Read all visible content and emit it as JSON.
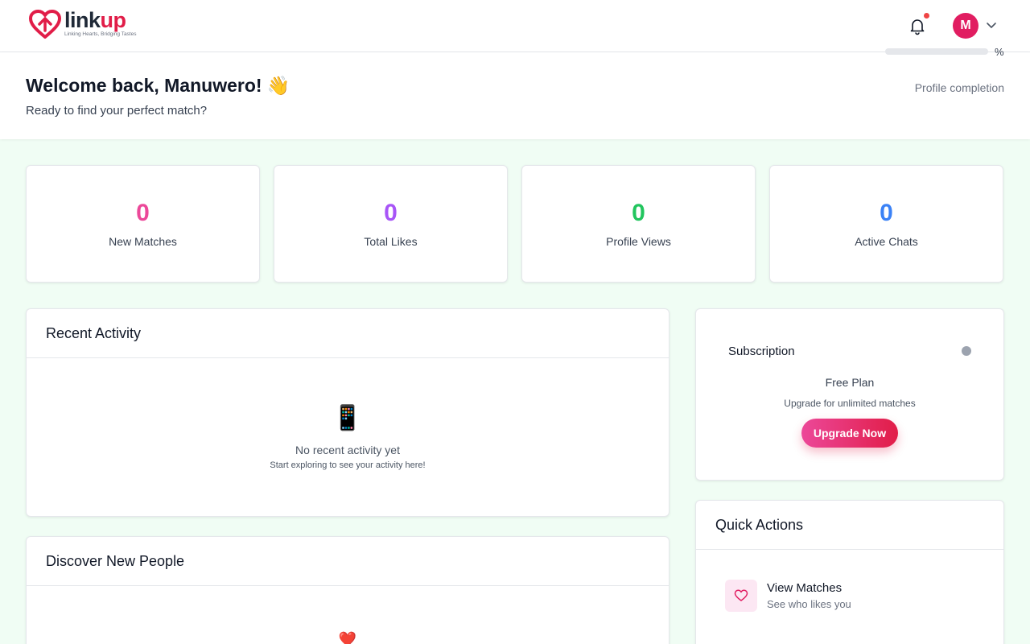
{
  "header": {
    "logo_name_part1": "link",
    "logo_name_part2": "up",
    "logo_tagline": "Linking Hearts, Bridging Tastes",
    "avatar_initial": "M"
  },
  "welcome": {
    "title": "Welcome back, Manuwero! 👋",
    "subtitle": "Ready to find your perfect match?",
    "completion_label": "Profile completion",
    "completion_value": "%",
    "completion_fraction": 0
  },
  "stats": [
    {
      "value": "0",
      "label": "New Matches",
      "color": "#ec4899"
    },
    {
      "value": "0",
      "label": "Total Likes",
      "color": "#a855f7"
    },
    {
      "value": "0",
      "label": "Profile Views",
      "color": "#22c55e"
    },
    {
      "value": "0",
      "label": "Active Chats",
      "color": "#3b82f6"
    }
  ],
  "recent_activity": {
    "title": "Recent Activity",
    "empty_icon": "📱",
    "empty_title": "No recent activity yet",
    "empty_sub": "Start exploring to see your activity here!"
  },
  "discover": {
    "title": "Discover New People",
    "icon": "❤️"
  },
  "subscription": {
    "title": "Subscription",
    "plan": "Free Plan",
    "note": "Upgrade for unlimited matches",
    "button": "Upgrade Now"
  },
  "quick_actions": {
    "title": "Quick Actions",
    "items": [
      {
        "title": "View Matches",
        "subtitle": "See who likes you",
        "icon": "heart-icon"
      }
    ]
  },
  "colors": {
    "brand": "#e11d48",
    "background": "#f0fdf4"
  }
}
